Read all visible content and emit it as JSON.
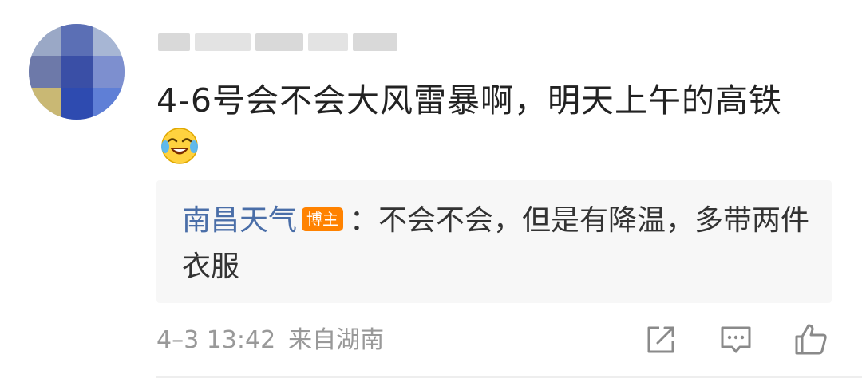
{
  "comment": {
    "text": "4-6号会不会大风雷暴啊，明天上午的高铁",
    "emoji": "laughing-crying-emoji",
    "timestamp": "4–3 13:42",
    "source": "来自湖南"
  },
  "reply": {
    "author": "南昌天气",
    "badge": "博主",
    "separator": "：",
    "text": "不会不会，但是有降温，多带两件衣服"
  },
  "actions": {
    "share": "share-icon",
    "comment": "comment-icon",
    "like": "like-icon"
  },
  "colors": {
    "author_link": "#4a6ea8",
    "badge_bg": "#ff8200",
    "reply_bg": "#f7f7f7",
    "meta_text": "#999999"
  }
}
